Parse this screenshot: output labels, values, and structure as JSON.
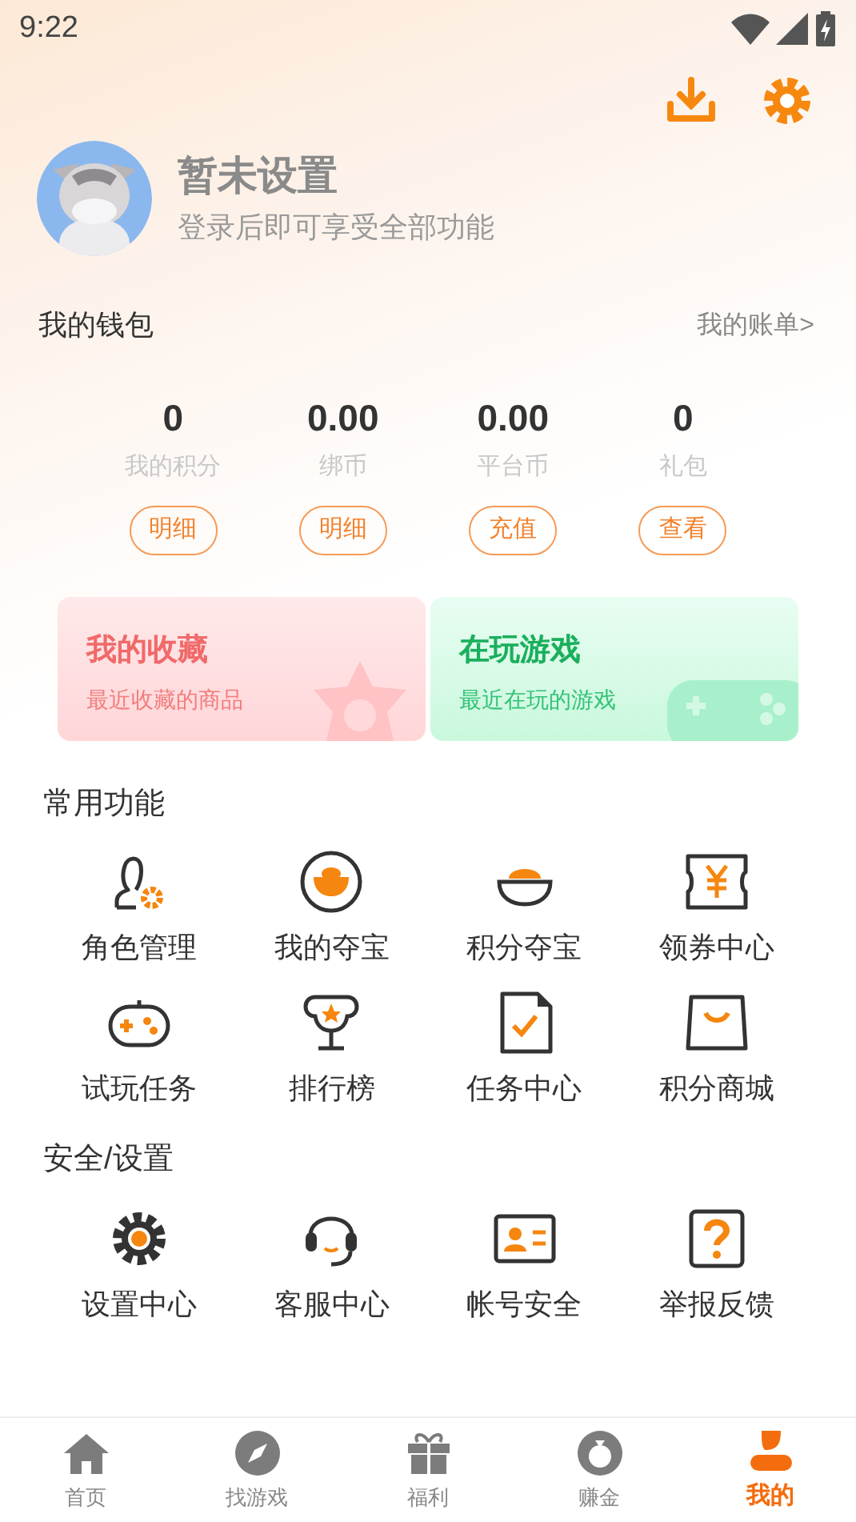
{
  "status_bar": {
    "time": "9:22"
  },
  "profile": {
    "name": "暂未设置",
    "subtitle": "登录后即可享受全部功能"
  },
  "wallet": {
    "title": "我的钱包",
    "link": "我的账单>",
    "stats": [
      {
        "value": "0",
        "label": "我的积分",
        "action": "明细"
      },
      {
        "value": "0.00",
        "label": "绑币",
        "action": "明细"
      },
      {
        "value": "0.00",
        "label": "平台币",
        "action": "充值"
      },
      {
        "value": "0",
        "label": "礼包",
        "action": "查看"
      }
    ]
  },
  "cards": [
    {
      "kind": "favorites",
      "title": "我的收藏",
      "subtitle": "最近收藏的商品"
    },
    {
      "kind": "playing",
      "title": "在玩游戏",
      "subtitle": "最近在玩的游戏"
    }
  ],
  "sections": [
    {
      "title": "常用功能",
      "items": [
        {
          "label": "角色管理"
        },
        {
          "label": "我的夺宝"
        },
        {
          "label": "积分夺宝"
        },
        {
          "label": "领券中心"
        },
        {
          "label": "试玩任务"
        },
        {
          "label": "排行榜"
        },
        {
          "label": "任务中心"
        },
        {
          "label": "积分商城"
        }
      ]
    },
    {
      "title": "安全/设置",
      "items": [
        {
          "label": "设置中心"
        },
        {
          "label": "客服中心"
        },
        {
          "label": "帐号安全"
        },
        {
          "label": "举报反馈"
        }
      ]
    }
  ],
  "tab_bar": [
    {
      "label": "首页",
      "selected": false
    },
    {
      "label": "找游戏",
      "selected": false
    },
    {
      "label": "福利",
      "selected": false
    },
    {
      "label": "赚金",
      "selected": false
    },
    {
      "label": "我的",
      "selected": true
    }
  ]
}
